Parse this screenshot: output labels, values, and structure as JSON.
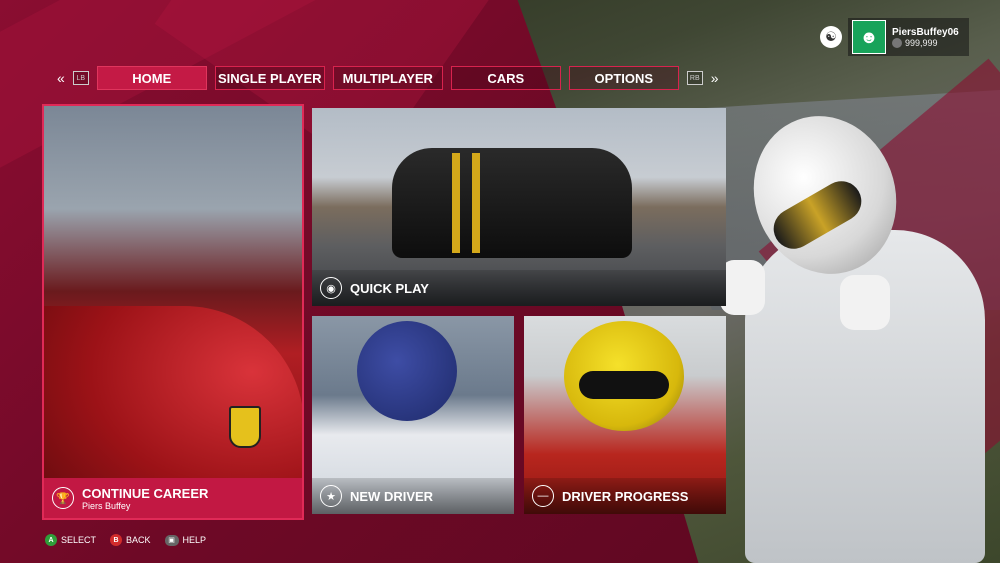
{
  "profile": {
    "username": "PiersBuffey06",
    "credits": "999,999"
  },
  "nav": {
    "lb": "LB",
    "rb": "RB",
    "prev_glyph": "«",
    "next_glyph": "»",
    "tabs": [
      {
        "label": "HOME",
        "active": true
      },
      {
        "label": "SINGLE PLAYER",
        "active": false
      },
      {
        "label": "MULTIPLAYER",
        "active": false
      },
      {
        "label": "CARS",
        "active": false
      },
      {
        "label": "OPTIONS",
        "active": false
      }
    ]
  },
  "tiles": {
    "career": {
      "label": "CONTINUE CAREER",
      "sub": "Piers Buffey",
      "icon": "trophy-icon"
    },
    "quick": {
      "label": "QUICK PLAY",
      "icon": "steering-wheel-icon"
    },
    "new_driver": {
      "label": "NEW DRIVER",
      "icon": "star-icon"
    },
    "progress": {
      "label": "DRIVER PROGRESS",
      "icon": "minus-circle-icon"
    }
  },
  "legend": {
    "a_btn": "A",
    "select": "SELECT",
    "b_btn": "B",
    "back": "BACK",
    "help": "HELP"
  },
  "colors": {
    "accent": "#c41a45",
    "background": "#7a0a2c"
  }
}
